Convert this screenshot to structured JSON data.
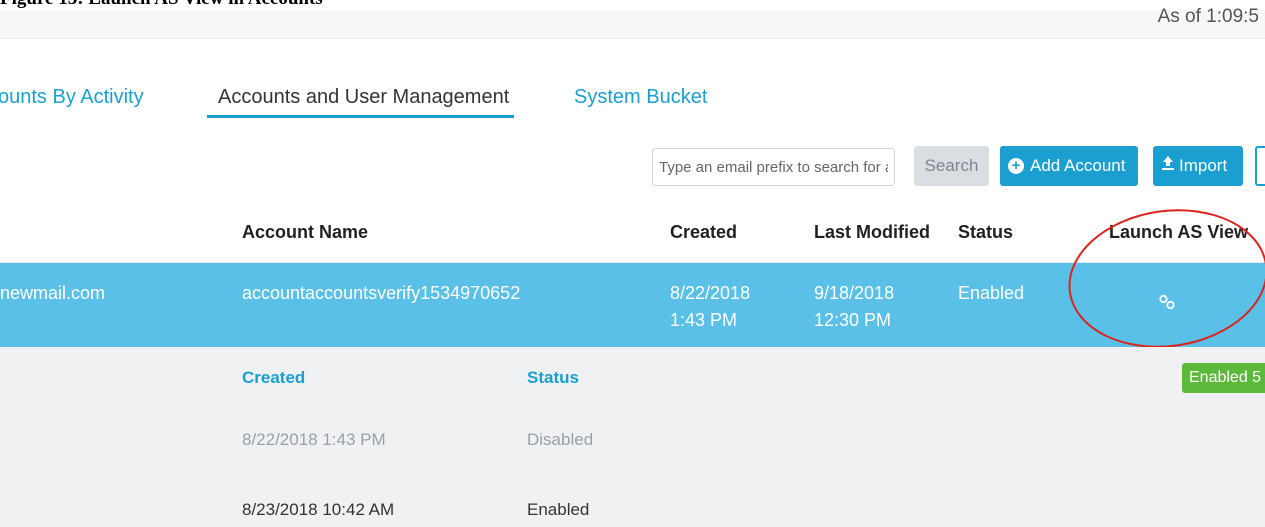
{
  "header": {
    "caption": "Figure 13: Launch AS View in Accounts",
    "as_of": "As of 1:09:5"
  },
  "tabs": [
    {
      "label": "ounts By Activity",
      "active": false
    },
    {
      "label": "Accounts and User Management",
      "active": true
    },
    {
      "label": "System Bucket",
      "active": false
    }
  ],
  "toolbar": {
    "search_placeholder": "Type an email prefix to search for a",
    "search_label": "Search",
    "add_account_label": "Add Account",
    "import_label": "Import"
  },
  "table": {
    "columns": [
      "Account Name",
      "Created",
      "Last Modified",
      "Status",
      "Launch AS View"
    ],
    "selected_row": {
      "email": "newmail.com",
      "account_name": "accountaccountsverify1534970652",
      "created": "8/22/2018 1:43 PM",
      "last_modified": "9/18/2018 12:30 PM",
      "status": "Enabled"
    }
  },
  "details": {
    "headers": [
      "Created",
      "Status"
    ],
    "rows": [
      {
        "created": "8/22/2018 1:43 PM",
        "status": "Disabled"
      },
      {
        "created": "8/23/2018 10:42 AM",
        "status": "Enabled"
      }
    ],
    "badge": "Enabled 5"
  },
  "icons": [
    "circle-plus-icon",
    "upload-icon",
    "link-icon"
  ],
  "colors": {
    "accent": "#1a9fd0",
    "row_highlight": "#5bc0e7",
    "badge_green": "#5cb93a",
    "annotation_red": "#d9251d"
  }
}
